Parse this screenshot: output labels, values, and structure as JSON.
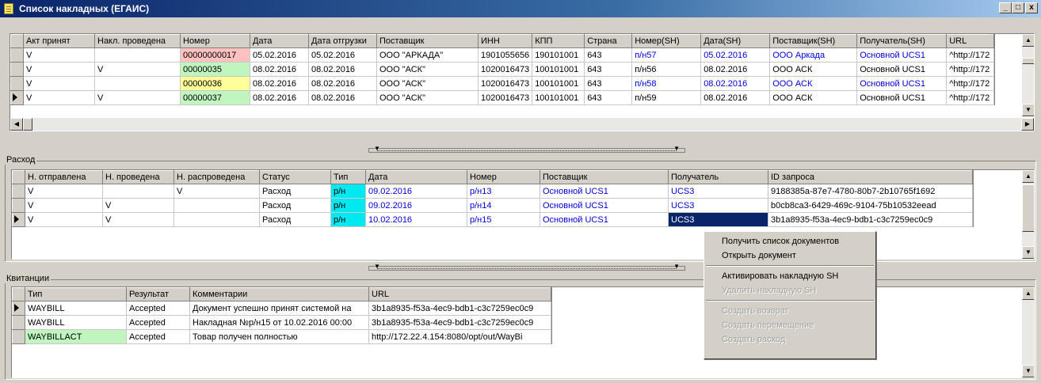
{
  "window": {
    "title": "Список накладных (ЕГАИС)",
    "btn_min": "_",
    "btn_max": "□",
    "btn_close": "x"
  },
  "incoming": {
    "columns": [
      "Акт принят",
      "Накл. проведена",
      "Номер",
      "Дата",
      "Дата отгрузки",
      "Поставщик",
      "ИНН",
      "КПП",
      "Страна",
      "Номер(SH)",
      "Дата(SH)",
      "Поставщик(SH)",
      "Получатель(SH)",
      "URL"
    ],
    "rows": [
      [
        "V",
        "",
        "00000000017",
        "05.02.2016",
        "05.02.2016",
        "ООО \"АРКАДА\"",
        "1901055656",
        "190101001",
        "643",
        "п/н57",
        "05.02.2016",
        "ООО Аркада",
        "Основной UCS1",
        "^http://172"
      ],
      [
        "V",
        "V",
        "00000035",
        "08.02.2016",
        "08.02.2016",
        "ООО \"АСК\"",
        "1020016473",
        "100101001",
        "643",
        "п/н56",
        "08.02.2016",
        "ООО АСК",
        "Основной UCS1",
        "^http://172"
      ],
      [
        "V",
        "",
        "00000036",
        "08.02.2016",
        "08.02.2016",
        "ООО \"АСК\"",
        "1020016473",
        "100101001",
        "643",
        "п/н58",
        "08.02.2016",
        "ООО АСК",
        "Основной UCS1",
        "^http://172"
      ],
      [
        "V",
        "V",
        "00000037",
        "08.02.2016",
        "08.02.2016",
        "ООО \"АСК\"",
        "1020016473",
        "100101001",
        "643",
        "п/н59",
        "08.02.2016",
        "ООО АСК",
        "Основной UCS1",
        "^http://172"
      ]
    ]
  },
  "outgoing": {
    "label": "Расход",
    "columns": [
      "Н. отправлена",
      "Н. проведена",
      "Н. распроведена",
      "Статус",
      "Тип",
      "Дата",
      "Номер",
      "Поставщик",
      "Получатель",
      "ID запроса"
    ],
    "rows": [
      [
        "V",
        "",
        "V",
        "Расход",
        "р/н",
        "09.02.2016",
        "р/н13",
        "Основной UCS1",
        "UCS3",
        "9188385a-87e7-4780-80b7-2b10765f1692"
      ],
      [
        "V",
        "V",
        "",
        "Расход",
        "р/н",
        "09.02.2016",
        "р/н14",
        "Основной UCS1",
        "UCS3",
        "b0cb8ca3-6429-469c-9104-75b10532eead"
      ],
      [
        "V",
        "V",
        "",
        "Расход",
        "р/н",
        "10.02.2016",
        "р/н15",
        "Основной UCS1",
        "UCS3",
        "3b1a8935-f53a-4ec9-bdb1-c3c7259ec0c9"
      ]
    ]
  },
  "receipts": {
    "label": "Квитанции",
    "columns": [
      "Тип",
      "Результат",
      "Комментарии",
      "URL"
    ],
    "rows": [
      [
        "WAYBILL",
        "Accepted",
        "Документ успешно принят системой на",
        "3b1a8935-f53a-4ec9-bdb1-c3c7259ec0c9"
      ],
      [
        "WAYBILL",
        "Accepted",
        "Накладная №р/н15 от 10.02.2016 00:00",
        "3b1a8935-f53a-4ec9-bdb1-c3c7259ec0c9"
      ],
      [
        "WAYBILLACT",
        "Accepted",
        "Товар получен полностью",
        "http://172.22.4.154:8080/opt/out/WayBi"
      ]
    ]
  },
  "context_menu": {
    "items": [
      {
        "label": "Получить список документов",
        "enabled": true
      },
      {
        "label": "Открыть документ",
        "enabled": true
      },
      {
        "label": "Активировать накладную SH",
        "enabled": true
      },
      {
        "label": "Удалить накладную SH",
        "enabled": false
      },
      {
        "label": "Создать возврат",
        "enabled": false
      },
      {
        "label": "Создать перемещение",
        "enabled": false
      },
      {
        "label": "Создать расход",
        "enabled": false
      }
    ]
  },
  "colors": {
    "title_bar": "#0a246a",
    "link_blue": "#0000e0",
    "highlight_red": "#ffc0c0",
    "highlight_green": "#c0f5c0",
    "highlight_yellow": "#ffff99",
    "highlight_cyan": "#00e8f0",
    "selection": "#0a246a"
  }
}
